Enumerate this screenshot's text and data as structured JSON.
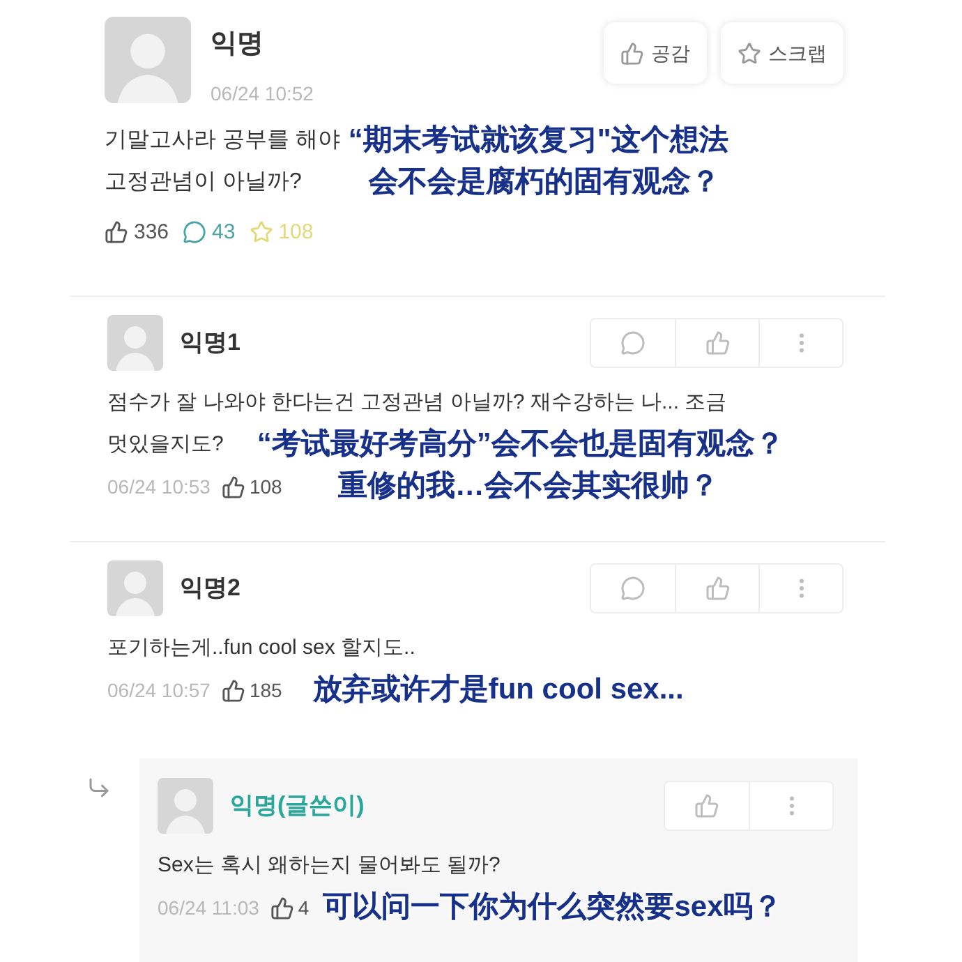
{
  "post": {
    "author": "익명",
    "time": "06/24 10:52",
    "body": [
      "기말고사라 공부를 해야",
      "고정관념이 아닐까?"
    ],
    "buttons": [
      {
        "kind": "like",
        "label": "공감"
      },
      {
        "kind": "scrap",
        "label": "스크랩"
      }
    ],
    "likes": "336",
    "comments": "43",
    "scraps": "108",
    "caption": [
      "“期末考试就该复习\"这个想法",
      "会不会是腐朽的固有观念？"
    ]
  },
  "comments": [
    {
      "author": "익명1",
      "is_op": false,
      "is_reply": false,
      "actions": [
        {
          "kind": "comment"
        },
        {
          "kind": "like"
        },
        {
          "kind": "more"
        }
      ],
      "body": [
        "점수가 잘 나와야 한다는건 고정관념 아닐까? 재수강하는 나... 조금",
        "멋있을지도?"
      ],
      "time": "06/24 10:53",
      "likes": "108",
      "caption": [
        "“考试最好考高分”会不会也是固有观念？",
        "重修的我…会不会其实很帅？"
      ]
    },
    {
      "author": "익명2",
      "is_op": false,
      "is_reply": false,
      "actions": [
        {
          "kind": "comment"
        },
        {
          "kind": "like"
        },
        {
          "kind": "more"
        }
      ],
      "body": [
        "포기하는게..fun cool sex 할지도.."
      ],
      "time": "06/24 10:57",
      "likes": "185",
      "caption": [
        "放弃或许才是fun cool sex..."
      ]
    },
    {
      "author": "익명(글쓴이)",
      "is_op": true,
      "is_reply": true,
      "actions": [
        {
          "kind": "like"
        },
        {
          "kind": "more"
        }
      ],
      "body": [
        "Sex는 혹시 왜하는지 물어봐도 될까?"
      ],
      "time": "06/24 11:03",
      "likes": "4",
      "caption": [
        "可以问一下你为什么突然要sex吗？"
      ]
    }
  ]
}
